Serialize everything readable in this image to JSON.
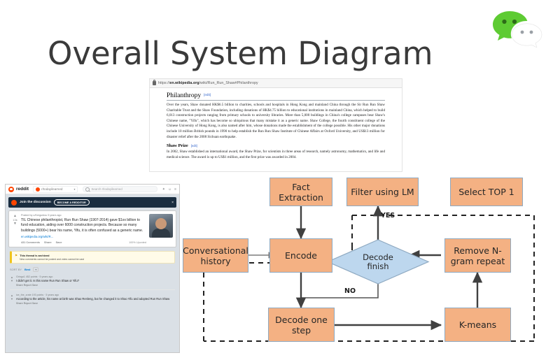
{
  "slide": {
    "title": "Overall System Diagram",
    "logo_name": "wechat-logo"
  },
  "wikipedia": {
    "url_prefix": "https://",
    "url_domain": "en.wikipedia.org",
    "url_path": "/wiki/Run_Run_Shaw#Philanthropy",
    "heading": "Philanthropy",
    "edit_label": "[edit]",
    "paragraph": "Over the years, Shaw donated HK$6.5 billion to charities, schools and hospitals in Hong Kong and mainland China through the Sir Run Run Shaw Charitable Trust and the Shaw Foundation, including donations of HK$4.75 billion to educational institutions in mainland China, which helped to build 6,013 construction projects ranging from primary schools to university libraries. More than 5,000 buildings in China's college campuses bear Shaw's Chinese name, \"Yifu\", which has become so ubiquitous that many mistake it as a generic name. Shaw College, the fourth constituent college of the Chinese University of Hong Kong, is also named after him, whose donations made the establishment of the college possible. His other major donations include 10 million British pounds in 1990 to help establish the Run Run Shaw Institute of Chinese Affairs at Oxford University, and US$13 million for disaster relief after the 2008 Sichuan earthquake.",
    "subheading": "Shaw Prize",
    "sub_edit_label": "[edit]",
    "sub_paragraph": "In 2002, Shaw established an international award, the Shaw Prize, for scientists in three areas of research, namely astronomy, mathematics, and life and medical science. The award is up to US$1 million, and the first prize was awarded in 2004."
  },
  "reddit": {
    "wordmark": "reddit",
    "subreddit": "r/todayilearned",
    "search_placeholder": "Search r/todayilearned",
    "banner_title": "Join the discussion",
    "banner_button": "BECOME A REDDITOR",
    "post_meta": "Posted by u/Kerguidou 5 years ago",
    "post_title": "TIL Chinese philanthropist, Run Run Shaw (1907-2014) gave $1xx billion to fund education, aiding over 6000 construction projects. Because so many buildings (5000+) bear his name, Yifu, it is often confused as a generic name.",
    "post_link": "en.wikipedia.org/wiki/R...",
    "action_comments": "431 Comments",
    "action_share": "Share",
    "action_save": "Save",
    "action_right": "100% Upvoted",
    "archived_title": "This thread is archived",
    "archived_sub": "New comments cannot be posted and votes cannot be cast",
    "sort_label": "SORT BY",
    "sort_value": "Best",
    "comments": [
      {
        "meta": "Gringo1 452 points · 5 years ago",
        "text": "I didn't get it. Is this name Run Run Shaw or Yifu?",
        "actions": "Share  Report  Save"
      },
      {
        "meta": "ice_the_crate 193 points · 5 years ago",
        "text": "According to the article, his name at birth was Shao Renleng, but he changed it to Shao Yifu and adopted Run Run Shaw",
        "actions": "Share  Report  Save"
      }
    ]
  },
  "flowchart": {
    "colors": {
      "box_fill": "#F4B183",
      "box_stroke": "#8EA9C1",
      "diamond_fill": "#BDD7EE",
      "diamond_stroke": "#8EA9C1",
      "edge": "#404040"
    },
    "nodes": [
      {
        "id": "fact_extraction",
        "label": "Fact\nExtraction",
        "shape": "rect"
      },
      {
        "id": "filter_using_lm",
        "label": "Filter using LM",
        "shape": "rect"
      },
      {
        "id": "select_top_1",
        "label": "Select TOP 1",
        "shape": "rect"
      },
      {
        "id": "conversational_history",
        "label": "Conversational\nhistory",
        "shape": "rect"
      },
      {
        "id": "encode",
        "label": "Encode",
        "shape": "rect"
      },
      {
        "id": "decode_finish",
        "label": "Decode\nfinish",
        "shape": "diamond"
      },
      {
        "id": "remove_ngram",
        "label": "Remove N-\ngram repeat",
        "shape": "rect"
      },
      {
        "id": "decode_one_step",
        "label": "Decode one\nstep",
        "shape": "rect"
      },
      {
        "id": "kmeans",
        "label": "K-means",
        "shape": "rect"
      }
    ],
    "edge_labels": {
      "yes": "YES",
      "no": "NO"
    },
    "edges": [
      {
        "from": "fact_extraction",
        "to": "encode"
      },
      {
        "from": "conversational_history",
        "to": "encode"
      },
      {
        "from": "filter_using_lm",
        "to": "select_top_1"
      },
      {
        "from": "decode_finish",
        "to": "filter_using_lm",
        "label": "YES"
      },
      {
        "from": "decode_finish",
        "to": "decode_one_step",
        "label": "NO"
      },
      {
        "from": "encode",
        "to": "decode_one_step"
      },
      {
        "from": "decode_one_step",
        "to": "kmeans"
      },
      {
        "from": "kmeans",
        "to": "remove_ngram"
      },
      {
        "from": "remove_ngram",
        "to": "decode_finish"
      }
    ]
  }
}
